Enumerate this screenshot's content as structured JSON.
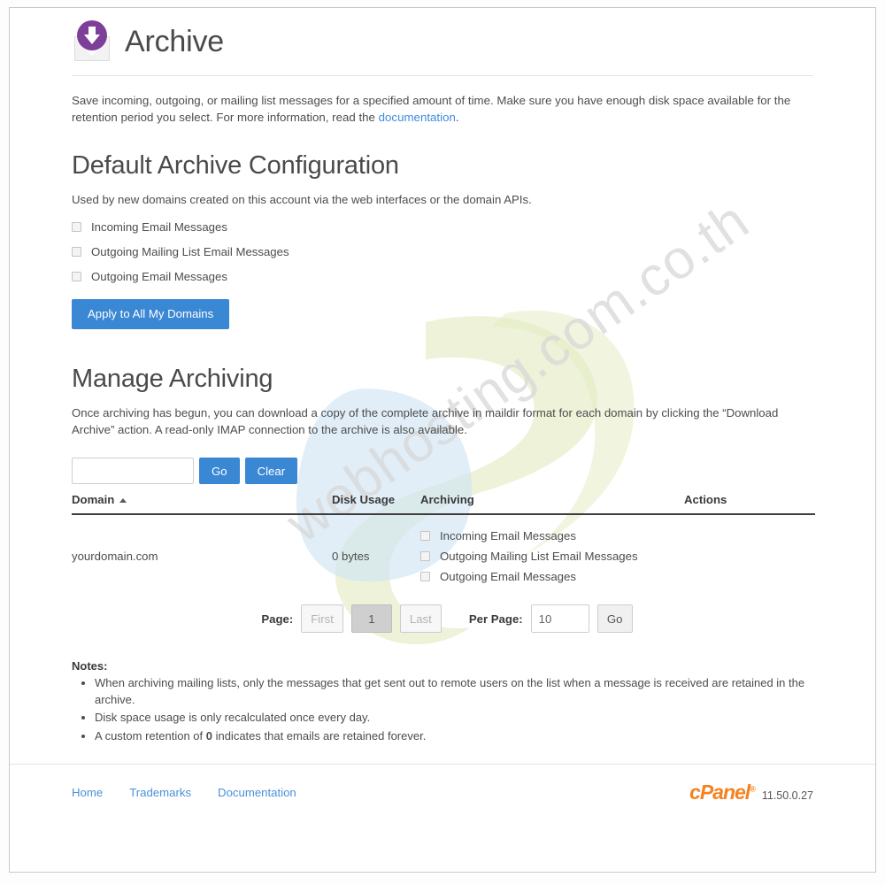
{
  "page": {
    "title": "Archive",
    "icon": "archive-download-envelope-icon",
    "intro": "Save incoming, outgoing, or mailing list messages for a specified amount of time. Make sure you have enough disk space available for the retention period you select. For more information, read the ",
    "intro_link": "documentation",
    "intro_suffix": "."
  },
  "default_config": {
    "heading": "Default Archive Configuration",
    "description": "Used by new domains created on this account via the web interfaces or the domain APIs.",
    "options": [
      {
        "label": "Incoming Email Messages",
        "checked": false
      },
      {
        "label": "Outgoing Mailing List Email Messages",
        "checked": false
      },
      {
        "label": "Outgoing Email Messages",
        "checked": false
      }
    ],
    "apply_button": "Apply to All My Domains"
  },
  "manage": {
    "heading": "Manage Archiving",
    "description": "Once archiving has begun, you can download a copy of the complete archive in maildir format for each domain by clicking the “Download Archive” action. A read-only IMAP connection to the archive is also available.",
    "search": {
      "value": "",
      "placeholder": "",
      "go_label": "Go",
      "clear_label": "Clear"
    },
    "table": {
      "columns": [
        "Domain",
        "Disk Usage",
        "Archiving",
        "Actions"
      ],
      "sort_column": "Domain",
      "sort_direction": "ascending",
      "rows": [
        {
          "domain": "yourdomain.com",
          "disk_usage": "0 bytes",
          "archiving": [
            {
              "label": "Incoming Email Messages",
              "checked": false
            },
            {
              "label": "Outgoing Mailing List Email Messages",
              "checked": false
            },
            {
              "label": "Outgoing Email Messages",
              "checked": false
            }
          ],
          "actions": ""
        }
      ]
    },
    "pagination": {
      "page_label": "Page:",
      "first_label": "First",
      "current_page": "1",
      "last_label": "Last",
      "per_page_label": "Per Page:",
      "per_page_value": "10",
      "go_label": "Go"
    }
  },
  "notes": {
    "title": "Notes:",
    "items": [
      "When archiving mailing lists, only the messages that get sent out to remote users on the list when a message is received are retained in the archive.",
      "Disk space usage is only recalculated once every day.",
      "A custom retention of 0 indicates that emails are retained forever."
    ]
  },
  "footer": {
    "links": [
      "Home",
      "Trademarks",
      "Documentation"
    ],
    "brand": "cPanel",
    "version": "11.50.0.27"
  },
  "watermark": {
    "text": "webhosting.com.co.th"
  },
  "colors": {
    "primary_button": "#3a87d4",
    "link": "#4a90d9",
    "brand_orange": "#f58220",
    "icon_purple": "#7d3f98"
  }
}
